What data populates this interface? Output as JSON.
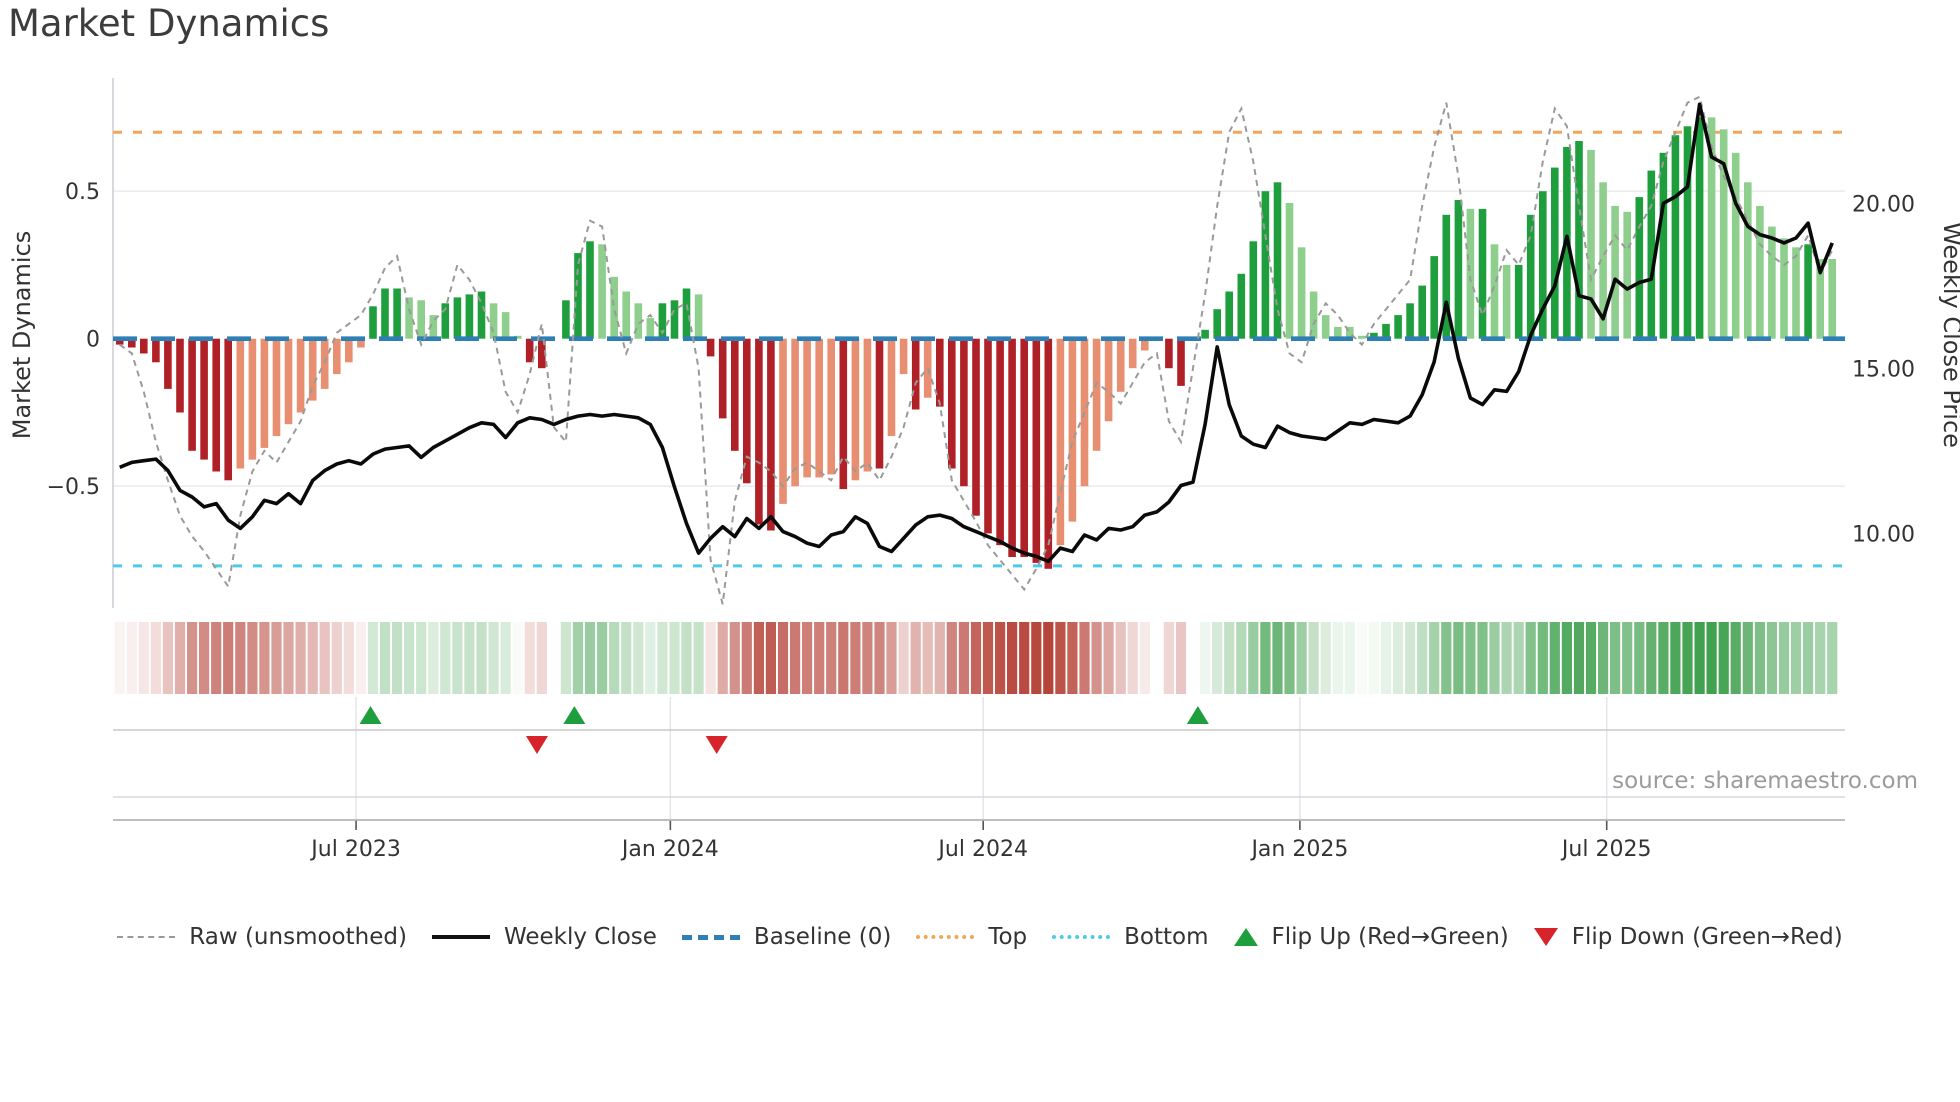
{
  "title": "Market Dynamics",
  "source_text": "source: sharemaestro.com",
  "axes": {
    "left_title": "Market Dynamics",
    "right_title": "Weekly Close Price",
    "left_ticks": [
      {
        "label": "0.5",
        "value": 0.5
      },
      {
        "label": "0",
        "value": 0
      },
      {
        "label": "−0.5",
        "value": -0.5
      }
    ],
    "right_ticks": [
      {
        "label": "20.00",
        "value": 20
      },
      {
        "label": "15.00",
        "value": 15
      },
      {
        "label": "10.00",
        "value": 10
      }
    ],
    "x_ticks": [
      {
        "label": "Jul 2023",
        "week": 19.6
      },
      {
        "label": "Jan 2024",
        "week": 45.66
      },
      {
        "label": "Jul 2024",
        "week": 71.6
      },
      {
        "label": "Jan 2025",
        "week": 97.86
      },
      {
        "label": "Jul 2025",
        "week": 123.3
      }
    ]
  },
  "legend": {
    "items": [
      {
        "id": "raw",
        "label": "Raw (unsmoothed)",
        "swatch": "sw-raw"
      },
      {
        "id": "weekly-close",
        "label": "Weekly Close",
        "swatch": "sw-close"
      },
      {
        "id": "baseline",
        "label": "Baseline (0)",
        "swatch": "sw-baseline"
      },
      {
        "id": "top",
        "label": "Top",
        "swatch": "sw-top"
      },
      {
        "id": "bottom",
        "label": "Bottom",
        "swatch": "sw-bottom"
      },
      {
        "id": "flip-up",
        "label": "Flip Up (Red→Green)",
        "swatch": "tri-up"
      },
      {
        "id": "flip-down",
        "label": "Flip Down (Green→Red)",
        "swatch": "tri-down"
      }
    ]
  },
  "colors": {
    "bar_dark_red": "#b02127",
    "bar_light_red": "#e78f70",
    "bar_dark_green": "#1f9e3d",
    "bar_light_green": "#8fcf8e",
    "price_line": "#0a0a0a",
    "raw_line": "#9a9a9a",
    "baseline": "#2f7fb7",
    "top_line": "#f3a559",
    "bottom_line": "#4ec9ea",
    "flip_up": "#1f9e3d",
    "flip_down": "#d7232a",
    "heat_green": [
      60,
      158,
      74
    ],
    "heat_red": [
      182,
      68,
      58
    ]
  },
  "chart_data": {
    "type": "bar",
    "description": "Weekly market-dynamics oscillator bars with raw overlay (left axis), weekly close price line (right axis), heatmap strip and regime-flip markers",
    "x_unit": "weeks (first bar mid-Feb 2023, weekly spacing)",
    "baseline": 0,
    "top_threshold": 0.7,
    "bottom_threshold": -0.77,
    "ylim_left": [
      -0.9,
      0.88
    ],
    "legend_position": "bottom",
    "grid": "horizontal at ±0.5",
    "markers": {
      "flip_up_weeks": [
        20.8,
        37.7,
        89.4
      ],
      "flip_down_weeks": [
        34.6,
        49.5
      ]
    },
    "series": [
      {
        "name": "Market Dynamics (smoothed bars)",
        "axis": "left",
        "values": [
          -0.02,
          -0.03,
          -0.05,
          -0.08,
          -0.17,
          -0.25,
          -0.38,
          -0.41,
          -0.45,
          -0.48,
          -0.44,
          -0.41,
          -0.37,
          -0.33,
          -0.29,
          -0.25,
          -0.21,
          -0.17,
          -0.12,
          -0.08,
          -0.03,
          0.11,
          0.17,
          0.17,
          0.14,
          0.13,
          0.08,
          0.12,
          0.14,
          0.15,
          0.16,
          0.12,
          0.09,
          0.01,
          -0.08,
          -0.1,
          0.0,
          0.13,
          0.29,
          0.33,
          0.32,
          0.21,
          0.16,
          0.12,
          0.07,
          0.12,
          0.13,
          0.17,
          0.15,
          -0.06,
          -0.27,
          -0.38,
          -0.49,
          -0.63,
          -0.65,
          -0.56,
          -0.5,
          -0.47,
          -0.47,
          -0.46,
          -0.51,
          -0.48,
          -0.45,
          -0.44,
          -0.33,
          -0.12,
          -0.24,
          -0.2,
          -0.23,
          -0.44,
          -0.5,
          -0.6,
          -0.66,
          -0.7,
          -0.74,
          -0.74,
          -0.76,
          -0.78,
          -0.7,
          -0.62,
          -0.5,
          -0.38,
          -0.28,
          -0.18,
          -0.1,
          -0.04,
          0.0,
          -0.1,
          -0.16,
          0.0,
          0.03,
          0.1,
          0.16,
          0.22,
          0.33,
          0.5,
          0.53,
          0.46,
          0.31,
          0.16,
          0.08,
          0.04,
          0.04,
          0.01,
          0.02,
          0.05,
          0.08,
          0.12,
          0.18,
          0.28,
          0.42,
          0.47,
          0.44,
          0.44,
          0.32,
          0.25,
          0.25,
          0.42,
          0.5,
          0.58,
          0.65,
          0.67,
          0.64,
          0.53,
          0.45,
          0.43,
          0.48,
          0.57,
          0.63,
          0.69,
          0.72,
          0.75,
          0.75,
          0.71,
          0.63,
          0.53,
          0.45,
          0.38,
          0.34,
          0.31,
          0.32,
          0.27,
          0.27
        ],
        "bar_colors": [
          "dr",
          "dr",
          "dr",
          "dr",
          "dr",
          "dr",
          "dr",
          "dr",
          "dr",
          "dr",
          "lr",
          "lr",
          "lr",
          "lr",
          "lr",
          "lr",
          "lr",
          "lr",
          "lr",
          "lr",
          "lr",
          "dg",
          "dg",
          "dg",
          "lg",
          "lg",
          "lg",
          "dg",
          "dg",
          "dg",
          "dg",
          "lg",
          "lg",
          "lg",
          "dr",
          "dr",
          "lg",
          "dg",
          "dg",
          "dg",
          "lg",
          "lg",
          "lg",
          "lg",
          "lg",
          "dg",
          "dg",
          "dg",
          "lg",
          "dr",
          "dr",
          "dr",
          "dr",
          "dr",
          "dr",
          "lr",
          "lr",
          "lr",
          "lr",
          "lr",
          "dr",
          "lr",
          "lr",
          "dr",
          "lr",
          "lr",
          "dr",
          "lr",
          "dr",
          "dr",
          "dr",
          "dr",
          "dr",
          "dr",
          "dr",
          "dr",
          "dr",
          "dr",
          "lr",
          "lr",
          "lr",
          "lr",
          "lr",
          "lr",
          "lr",
          "lr",
          "lg",
          "dr",
          "dr",
          "lg",
          "dg",
          "dg",
          "dg",
          "dg",
          "dg",
          "dg",
          "dg",
          "lg",
          "lg",
          "lg",
          "lg",
          "lg",
          "lg",
          "lg",
          "dg",
          "dg",
          "dg",
          "dg",
          "dg",
          "dg",
          "dg",
          "dg",
          "lg",
          "dg",
          "lg",
          "lg",
          "dg",
          "dg",
          "dg",
          "dg",
          "dg",
          "dg",
          "lg",
          "lg",
          "lg",
          "lg",
          "dg",
          "dg",
          "dg",
          "dg",
          "dg",
          "dg",
          "lg",
          "lg",
          "lg",
          "lg",
          "lg",
          "lg",
          "lg",
          "lg",
          "dg",
          "lg",
          "lg"
        ]
      },
      {
        "name": "Raw (unsmoothed)",
        "axis": "left",
        "values": [
          -0.02,
          -0.05,
          -0.18,
          -0.35,
          -0.48,
          -0.6,
          -0.67,
          -0.72,
          -0.78,
          -0.84,
          -0.6,
          -0.45,
          -0.38,
          -0.42,
          -0.35,
          -0.28,
          -0.16,
          -0.08,
          0.02,
          0.05,
          0.08,
          0.15,
          0.24,
          0.28,
          0.1,
          -0.02,
          0.06,
          0.1,
          0.25,
          0.2,
          0.12,
          0.02,
          -0.18,
          -0.25,
          -0.12,
          0.05,
          -0.3,
          -0.35,
          0.25,
          0.4,
          0.38,
          0.1,
          -0.05,
          0.05,
          0.08,
          0.02,
          0.1,
          0.12,
          -0.1,
          -0.75,
          -0.9,
          -0.55,
          -0.4,
          -0.42,
          -0.45,
          -0.5,
          -0.44,
          -0.42,
          -0.45,
          -0.48,
          -0.4,
          -0.45,
          -0.42,
          -0.48,
          -0.4,
          -0.3,
          -0.15,
          -0.1,
          -0.22,
          -0.48,
          -0.55,
          -0.62,
          -0.7,
          -0.75,
          -0.8,
          -0.85,
          -0.78,
          -0.7,
          -0.52,
          -0.35,
          -0.25,
          -0.15,
          -0.18,
          -0.22,
          -0.15,
          -0.08,
          -0.05,
          -0.28,
          -0.35,
          -0.1,
          0.15,
          0.45,
          0.7,
          0.78,
          0.6,
          0.35,
          0.1,
          -0.05,
          -0.08,
          0.05,
          0.12,
          0.08,
          0.02,
          -0.02,
          0.05,
          0.1,
          0.15,
          0.2,
          0.45,
          0.65,
          0.8,
          0.55,
          0.2,
          0.08,
          0.18,
          0.3,
          0.25,
          0.35,
          0.6,
          0.78,
          0.72,
          0.45,
          0.2,
          0.28,
          0.35,
          0.3,
          0.38,
          0.45,
          0.6,
          0.7,
          0.8,
          0.82,
          0.65,
          0.55,
          0.48,
          0.4,
          0.32,
          0.28,
          0.25,
          0.28,
          0.35,
          0.22,
          0.3
        ]
      },
      {
        "name": "Weekly Close",
        "axis": "right",
        "values": [
          12.0,
          12.15,
          12.2,
          12.25,
          11.9,
          11.3,
          11.1,
          10.8,
          10.9,
          10.4,
          10.15,
          10.5,
          11.0,
          10.9,
          11.2,
          10.9,
          11.6,
          11.9,
          12.1,
          12.2,
          12.1,
          12.4,
          12.55,
          12.6,
          12.65,
          12.3,
          12.6,
          12.8,
          13.0,
          13.2,
          13.35,
          13.3,
          12.9,
          13.35,
          13.5,
          13.45,
          13.3,
          13.45,
          13.55,
          13.6,
          13.55,
          13.6,
          13.55,
          13.5,
          13.3,
          12.6,
          11.4,
          10.3,
          9.4,
          9.85,
          10.2,
          9.9,
          10.45,
          10.15,
          10.5,
          10.05,
          9.9,
          9.7,
          9.6,
          9.95,
          10.05,
          10.5,
          10.3,
          9.6,
          9.45,
          9.85,
          10.25,
          10.5,
          10.55,
          10.45,
          10.2,
          10.05,
          9.9,
          9.75,
          9.55,
          9.4,
          9.3,
          9.15,
          9.55,
          9.45,
          9.95,
          9.8,
          10.15,
          10.1,
          10.2,
          10.55,
          10.65,
          10.95,
          11.45,
          11.55,
          13.3,
          15.65,
          13.9,
          12.95,
          12.7,
          12.6,
          13.25,
          13.05,
          12.95,
          12.9,
          12.85,
          13.1,
          13.35,
          13.3,
          13.45,
          13.4,
          13.35,
          13.55,
          14.2,
          15.2,
          17.0,
          15.3,
          14.1,
          13.9,
          14.35,
          14.3,
          14.9,
          16.0,
          16.8,
          17.5,
          19.0,
          17.2,
          17.1,
          16.5,
          17.7,
          17.4,
          17.6,
          17.7,
          20.0,
          20.2,
          20.5,
          23.0,
          21.4,
          21.2,
          20.0,
          19.3,
          19.05,
          18.95,
          18.8,
          18.95,
          19.4,
          17.9,
          18.8
        ]
      }
    ],
    "heatmap": "strip below main chart; cell color derived from smoothed bar value (white→green for positive, white→red for negative)"
  }
}
